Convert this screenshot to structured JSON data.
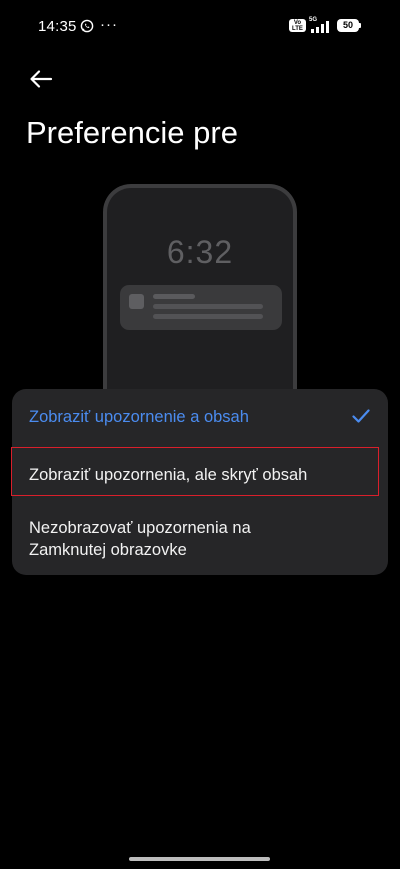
{
  "status_bar": {
    "time": "14:35",
    "more": "···",
    "volte": "Vo LTE",
    "network": "5G",
    "battery": "50",
    "icons": [
      "whatsapp-icon",
      "volte-icon",
      "signal-icon",
      "battery-icon"
    ]
  },
  "header": {
    "back_icon": "arrow-left-icon",
    "title": "Preferencie pre"
  },
  "preview": {
    "clock": "6:32"
  },
  "options": [
    {
      "label": "Zobraziť upozornenie a obsah",
      "selected": true
    },
    {
      "label": "Zobraziť upozornenia, ale skryť obsah",
      "selected": false,
      "highlighted": true
    },
    {
      "label": "Nezobrazovať upozornenia na Zamknutej obrazovke",
      "selected": false
    }
  ],
  "colors": {
    "accent": "#4b8cf0",
    "card": "#262628",
    "highlight_border": "#d91f2b",
    "background": "#000000"
  }
}
